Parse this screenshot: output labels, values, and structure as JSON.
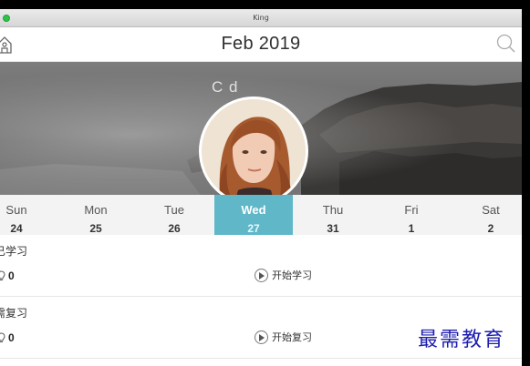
{
  "window": {
    "title": "King"
  },
  "header": {
    "month_label": "Feb 2019"
  },
  "banner": {
    "hint_text": "C             d"
  },
  "week": {
    "days": [
      {
        "name": "Sun",
        "date": "24"
      },
      {
        "name": "Mon",
        "date": "25"
      },
      {
        "name": "Tue",
        "date": "26"
      },
      {
        "name": "Wed",
        "date": "27"
      },
      {
        "name": "Thu",
        "date": "31"
      },
      {
        "name": "Fri",
        "date": "1"
      },
      {
        "name": "Sat",
        "date": "2"
      }
    ],
    "selected": "Wed"
  },
  "sections": [
    {
      "title": "已学习",
      "count": "0",
      "action_label": "开始学习"
    },
    {
      "title": "需复习",
      "count": "0",
      "action_label": "开始复习"
    }
  ],
  "watermark": "最需教育",
  "colors": {
    "accent": "#5fb7c8",
    "titlebar_close": "#2fc24a"
  }
}
